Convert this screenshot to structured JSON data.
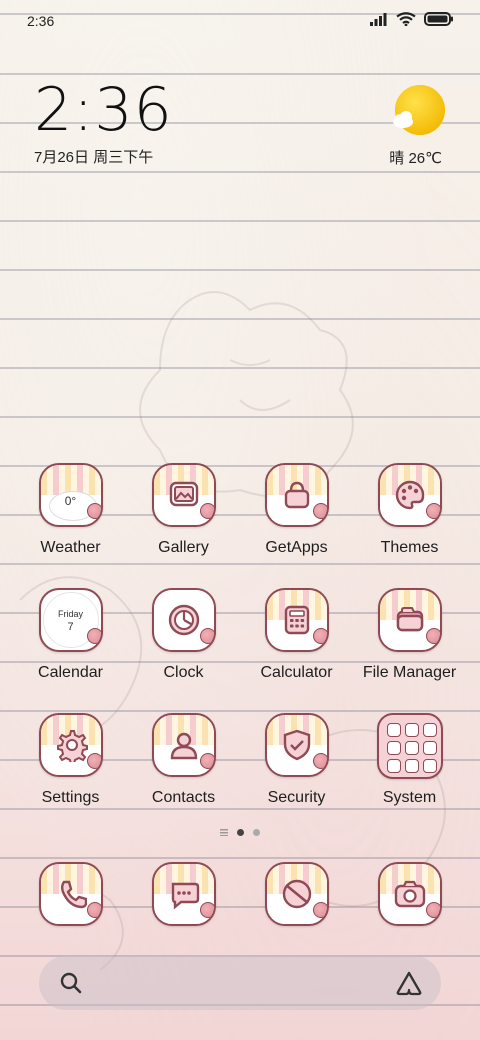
{
  "status_bar": {
    "time": "2:36",
    "icons": [
      "signal-icon",
      "wifi-icon",
      "battery-icon"
    ]
  },
  "clock_widget": {
    "time": "2:36",
    "date": "7月26日 周三下午"
  },
  "weather_widget": {
    "icon": "sunny-cloud-icon",
    "text": "晴 26℃"
  },
  "apps": [
    {
      "label": "Weather",
      "icon": "weather-icon",
      "inner_text": "0°"
    },
    {
      "label": "Gallery",
      "icon": "gallery-icon"
    },
    {
      "label": "GetApps",
      "icon": "shopping-bag-icon"
    },
    {
      "label": "Themes",
      "icon": "palette-icon"
    },
    {
      "label": "Calendar",
      "icon": "calendar-icon",
      "inner_day": "Friday",
      "inner_date": "7"
    },
    {
      "label": "Clock",
      "icon": "clock-icon"
    },
    {
      "label": "Calculator",
      "icon": "calculator-icon"
    },
    {
      "label": "File Manager",
      "icon": "folder-icon"
    },
    {
      "label": "Settings",
      "icon": "gear-icon"
    },
    {
      "label": "Contacts",
      "icon": "contact-icon"
    },
    {
      "label": "Security",
      "icon": "shield-icon"
    },
    {
      "label": "System",
      "icon": "system-folder-icon"
    }
  ],
  "dock": [
    {
      "icon": "phone-icon"
    },
    {
      "icon": "message-icon"
    },
    {
      "icon": "browser-icon"
    },
    {
      "icon": "camera-icon"
    }
  ],
  "pager": {
    "pages": 2,
    "active": 1
  },
  "search_bar": {
    "left_icon": "search-icon",
    "right_icon": "assistant-icon"
  },
  "colors": {
    "accent": "#8e4a55",
    "icon_pink": "#f6d2d6",
    "sun": "#f7c81a"
  }
}
